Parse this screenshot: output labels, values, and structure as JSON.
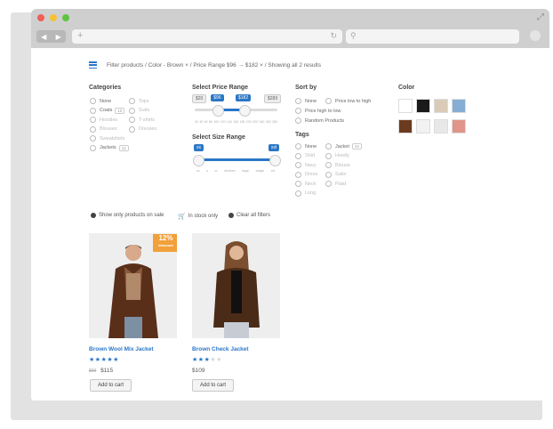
{
  "breadcrumb": "Filter products / Color - Brown  ×  / Price Range $96 → $182  ×  / Showing all 2 results",
  "categories": {
    "heading": "Categories",
    "col1": [
      {
        "label": "None",
        "muted": false,
        "count": ""
      },
      {
        "label": "Coats",
        "muted": false,
        "count": "10"
      },
      {
        "label": "Hoodies",
        "muted": true,
        "count": ""
      },
      {
        "label": "Blouses",
        "muted": true,
        "count": ""
      },
      {
        "label": "Sweatshirts",
        "muted": true,
        "count": ""
      },
      {
        "label": "Jackets",
        "muted": false,
        "count": "12"
      }
    ],
    "col2": [
      {
        "label": "Tops",
        "muted": true,
        "count": ""
      },
      {
        "label": "Suits",
        "muted": true,
        "count": ""
      },
      {
        "label": "T-shirts",
        "muted": true,
        "count": ""
      },
      {
        "label": "Dresses",
        "muted": true,
        "count": ""
      }
    ]
  },
  "price": {
    "heading": "Select Price Range",
    "min_label": "$20",
    "low_label": "$96",
    "high_label": "$182",
    "max_label": "$289",
    "range_min": 20,
    "range_max": 289,
    "low": 96,
    "high": 182,
    "ticks": [
      "20",
      "40",
      "60",
      "80",
      "100",
      "120",
      "140",
      "160",
      "180",
      "200",
      "220",
      "240",
      "260",
      "280"
    ]
  },
  "size": {
    "heading": "Select Size Range",
    "low_label": "xs",
    "high_label": "xxl",
    "low": 0,
    "high": 1,
    "ticks": [
      "xs",
      "s",
      "m",
      "medium",
      "large",
      "xlarge",
      "xxl"
    ]
  },
  "sortby": {
    "heading": "Sort by",
    "col1": [
      "None",
      "Price high to low",
      "Random Products"
    ],
    "col2": [
      "Price low to high"
    ]
  },
  "tags": {
    "heading": "Tags",
    "col1": [
      {
        "label": "None",
        "muted": false
      },
      {
        "label": "Shirt",
        "muted": true
      },
      {
        "label": "Navy",
        "muted": true
      },
      {
        "label": "Dress",
        "muted": true
      },
      {
        "label": "Neck",
        "muted": true
      },
      {
        "label": "Long",
        "muted": true
      }
    ],
    "col2": [
      {
        "label": "Jacket",
        "muted": false,
        "count": "44"
      },
      {
        "label": "Hoody",
        "muted": true,
        "count": ""
      },
      {
        "label": "Blouse",
        "muted": true,
        "count": ""
      },
      {
        "label": "Satin",
        "muted": true,
        "count": ""
      },
      {
        "label": "Plaid",
        "muted": true,
        "count": ""
      }
    ]
  },
  "color": {
    "heading": "Color",
    "swatches": [
      "#ffffff",
      "#1a1a1a",
      "#d9cbb7",
      "#86aed4",
      "#6b3b1f",
      "#f2f2f2",
      "#e8e8e8",
      "#e0948a"
    ]
  },
  "filterbar": {
    "on_sale": "Show only products on sale",
    "in_stock": "In stock only",
    "clear": "Clear all filters"
  },
  "products": [
    {
      "name": "Brown Wool Mix Jacket",
      "badge": "12%",
      "badge_sub": "discount",
      "rating": 5,
      "old_price": "$99",
      "price": "$115",
      "add_label": "Add to cart"
    },
    {
      "name": "Brown Check Jacket",
      "badge": "",
      "badge_sub": "",
      "rating": 3,
      "old_price": "",
      "price": "$109",
      "add_label": "Add to cart"
    }
  ]
}
